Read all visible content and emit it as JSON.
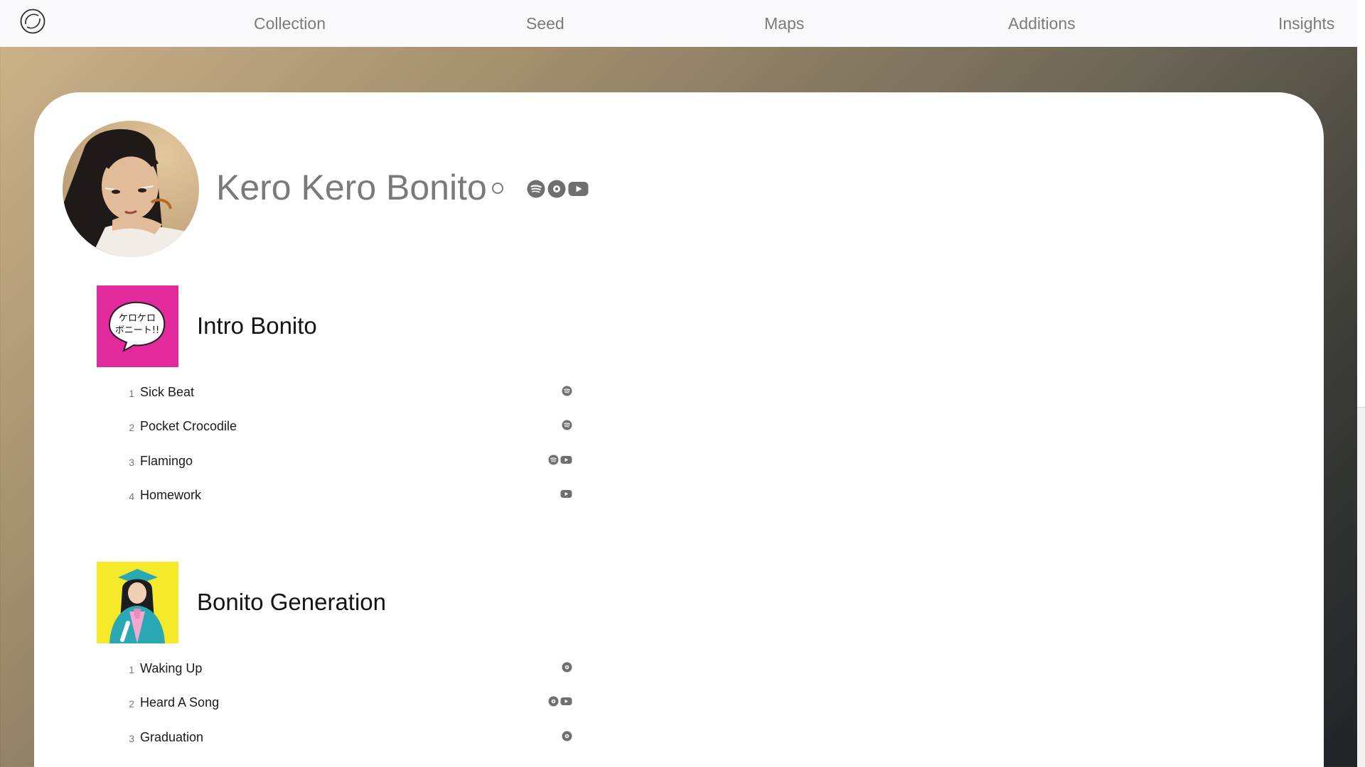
{
  "nav": {
    "logo_icon": "app-logo-circle-icon",
    "items": [
      "Collection",
      "Seed",
      "Maps",
      "Additions",
      "Insights"
    ]
  },
  "artist": {
    "name": "Kero Kero Bonito",
    "links": [
      "spotify-icon",
      "disc-icon",
      "youtube-icon"
    ]
  },
  "albums": [
    {
      "title": "Intro Bonito",
      "cover_text": "ケロケロ ボニート!!",
      "cover_color": "#e32a9c",
      "tracks": [
        {
          "num": "1",
          "title": "Sick Beat",
          "sources": [
            "spotify"
          ]
        },
        {
          "num": "2",
          "title": "Pocket Crocodile",
          "sources": [
            "spotify"
          ]
        },
        {
          "num": "3",
          "title": "Flamingo",
          "sources": [
            "spotify",
            "youtube"
          ]
        },
        {
          "num": "4",
          "title": "Homework",
          "sources": [
            "youtube"
          ]
        }
      ]
    },
    {
      "title": "Bonito Generation",
      "cover_color": "#f6e92a",
      "tracks": [
        {
          "num": "1",
          "title": "Waking Up",
          "sources": [
            "disc"
          ]
        },
        {
          "num": "2",
          "title": "Heard A Song",
          "sources": [
            "disc",
            "youtube"
          ]
        },
        {
          "num": "3",
          "title": "Graduation",
          "sources": [
            "disc"
          ]
        }
      ]
    }
  ],
  "colors": {
    "nav_bg": "#f8f8fd",
    "nav_text": "#7b7b7b",
    "icon_gray": "#6f6f6f",
    "accent_pink": "#e32a9c",
    "accent_yellow": "#f6e92a"
  }
}
